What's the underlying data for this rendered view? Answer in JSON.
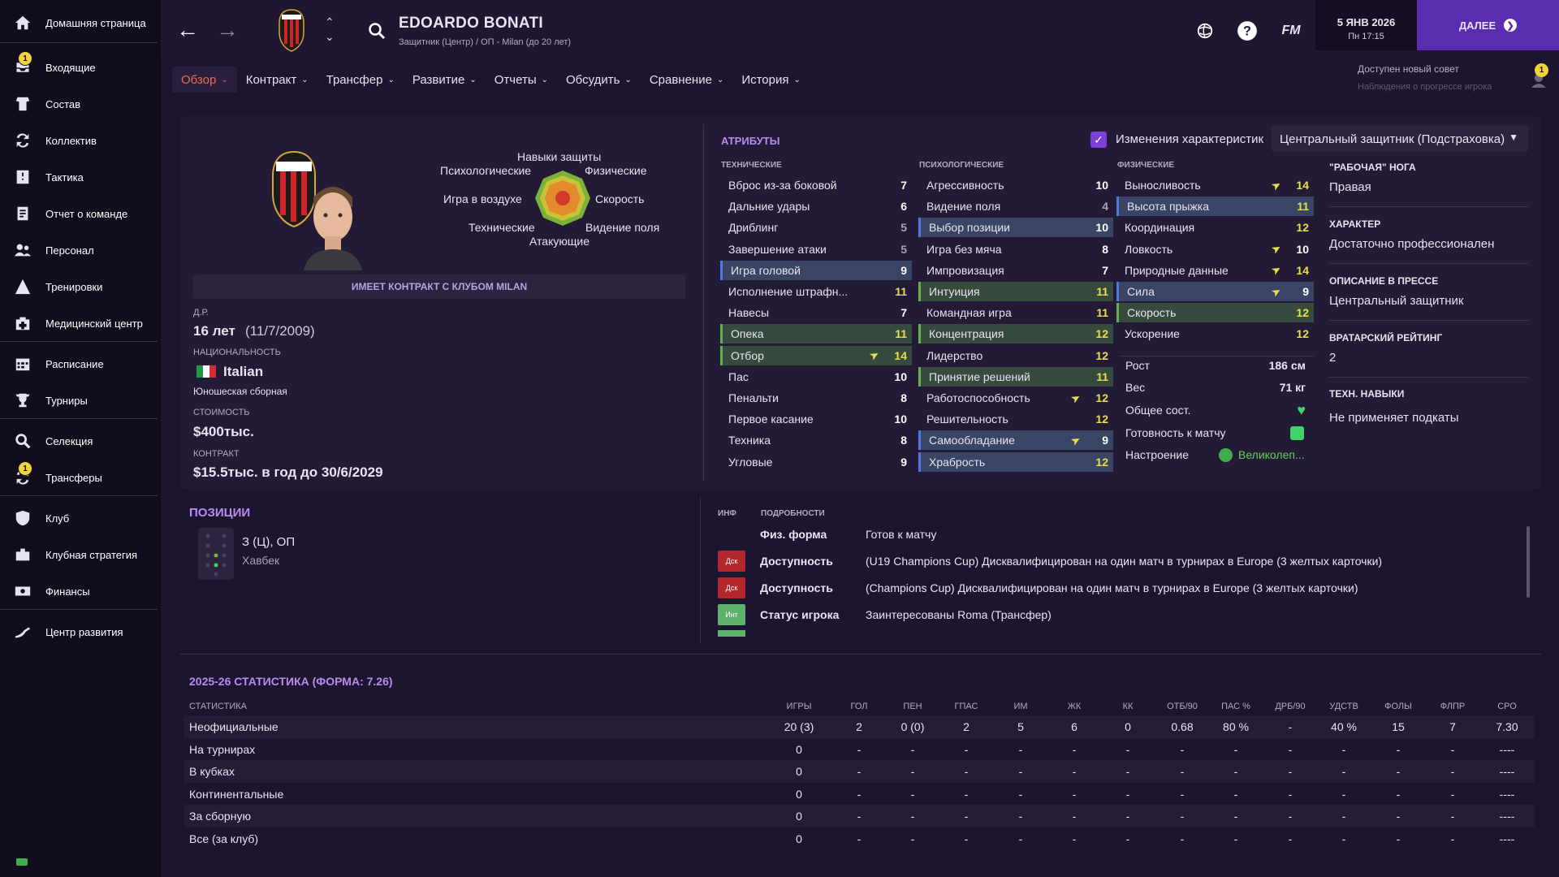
{
  "sidebar": {
    "items": [
      {
        "label": "Домашняя страница",
        "icon": "home-icon"
      },
      {
        "label": "Входящие",
        "icon": "inbox-icon",
        "badge": "1"
      },
      {
        "label": "Состав",
        "icon": "squad-icon"
      },
      {
        "label": "Коллектив",
        "icon": "dynamics-icon"
      },
      {
        "label": "Тактика",
        "icon": "tactics-icon"
      },
      {
        "label": "Отчет о команде",
        "icon": "report-icon"
      },
      {
        "label": "Персонал",
        "icon": "staff-icon"
      },
      {
        "label": "Тренировки",
        "icon": "training-icon"
      },
      {
        "label": "Медицинский центр",
        "icon": "medical-icon"
      },
      {
        "label": "Расписание",
        "icon": "calendar-icon"
      },
      {
        "label": "Турниры",
        "icon": "trophy-icon"
      },
      {
        "label": "Селекция",
        "icon": "scouting-icon"
      },
      {
        "label": "Трансферы",
        "icon": "transfers-icon",
        "badge": "1"
      },
      {
        "label": "Клуб",
        "icon": "club-icon"
      },
      {
        "label": "Клубная стратегия",
        "icon": "strategy-icon"
      },
      {
        "label": "Финансы",
        "icon": "finances-icon"
      },
      {
        "label": "Центр развития",
        "icon": "development-icon"
      }
    ]
  },
  "header": {
    "player_name": "EDOARDO BONATI",
    "player_sub": "Защитник (Центр) / ОП - Milan (до 20 лет)",
    "fm_logo": "FM",
    "date": "5 ЯНВ 2026",
    "day_time": "Пн 17:15",
    "next_label": "ДАЛЕЕ",
    "advice": "Доступен новый совет",
    "advice_sub": "Наблюдения о прогрессе игрока",
    "advice_badge": "1"
  },
  "tabs": [
    "Обзор",
    "Контракт",
    "Трансфер",
    "Развитие",
    "Отчеты",
    "Обсудить",
    "Сравнение",
    "История"
  ],
  "profile": {
    "radar": {
      "top": "Навыки защиты",
      "top_left": "Психологические",
      "top_right": "Физические",
      "left": "Игра в воздухе",
      "right": "Скорость",
      "bottom_left": "Технические",
      "bottom_right": "Видение поля",
      "bottom": "Атакующие"
    },
    "contract_bar": "ИМЕЕТ КОНТРАКТ С КЛУБОМ MILAN",
    "dob_label": "Д.Р.",
    "age": "16 лет",
    "dob": "(11/7/2009)",
    "nationality_label": "НАЦИОНАЛЬНОСТЬ",
    "nationality": "Italian",
    "nat_team": "Юношеская сборная",
    "value_label": "СТОИМОСТЬ",
    "value": "$400тыс.",
    "contract_label": "КОНТРАКТ",
    "contract": "$15.5тыс. в год до 30/6/2029"
  },
  "attributes": {
    "title": "АТРИБУТЫ",
    "changes_label": "Изменения характеристик",
    "role": "Центральный защитник (Подстраховка)",
    "technical_head": "ТЕХНИЧЕСКИЕ",
    "mental_head": "ПСИХОЛОГИЧЕСКИЕ",
    "physical_head": "ФИЗИЧЕСКИЕ",
    "technical": [
      {
        "name": "Вброс из-за боковой",
        "value": "7",
        "hl": "",
        "color": "white",
        "up": false
      },
      {
        "name": "Дальние удары",
        "value": "6",
        "hl": "",
        "color": "white",
        "up": false
      },
      {
        "name": "Дриблинг",
        "value": "5",
        "hl": "",
        "color": "grey",
        "up": false
      },
      {
        "name": "Завершение атаки",
        "value": "5",
        "hl": "",
        "color": "grey",
        "up": false
      },
      {
        "name": "Игра головой",
        "value": "9",
        "hl": "blue",
        "color": "white",
        "up": false
      },
      {
        "name": "Исполнение штрафн...",
        "value": "11",
        "hl": "",
        "color": "yellow",
        "up": false
      },
      {
        "name": "Навесы",
        "value": "7",
        "hl": "",
        "color": "white",
        "up": false
      },
      {
        "name": "Опека",
        "value": "11",
        "hl": "green",
        "color": "yellow",
        "up": false
      },
      {
        "name": "Отбор",
        "value": "14",
        "hl": "green",
        "color": "yellow",
        "up": true
      },
      {
        "name": "Пас",
        "value": "10",
        "hl": "",
        "color": "white",
        "up": false
      },
      {
        "name": "Пенальти",
        "value": "8",
        "hl": "",
        "color": "white",
        "up": false
      },
      {
        "name": "Первое касание",
        "value": "10",
        "hl": "",
        "color": "white",
        "up": false
      },
      {
        "name": "Техника",
        "value": "8",
        "hl": "",
        "color": "white",
        "up": false
      },
      {
        "name": "Угловые",
        "value": "9",
        "hl": "",
        "color": "white",
        "up": false
      }
    ],
    "mental": [
      {
        "name": "Агрессивность",
        "value": "10",
        "hl": "",
        "color": "white",
        "up": false
      },
      {
        "name": "Видение поля",
        "value": "4",
        "hl": "",
        "color": "grey",
        "up": false
      },
      {
        "name": "Выбор позиции",
        "value": "10",
        "hl": "blue",
        "color": "white",
        "up": false
      },
      {
        "name": "Игра без мяча",
        "value": "8",
        "hl": "",
        "color": "white",
        "up": false
      },
      {
        "name": "Импровизация",
        "value": "7",
        "hl": "",
        "color": "white",
        "up": false
      },
      {
        "name": "Интуиция",
        "value": "11",
        "hl": "green",
        "color": "yellow",
        "up": false
      },
      {
        "name": "Командная игра",
        "value": "11",
        "hl": "",
        "color": "yellow",
        "up": false
      },
      {
        "name": "Концентрация",
        "value": "12",
        "hl": "green",
        "color": "yellow",
        "up": false
      },
      {
        "name": "Лидерство",
        "value": "12",
        "hl": "",
        "color": "yellow",
        "up": false
      },
      {
        "name": "Принятие решений",
        "value": "11",
        "hl": "green",
        "color": "yellow",
        "up": false
      },
      {
        "name": "Работоспособность",
        "value": "12",
        "hl": "",
        "color": "yellow",
        "up": true
      },
      {
        "name": "Решительность",
        "value": "12",
        "hl": "",
        "color": "yellow",
        "up": false
      },
      {
        "name": "Самообладание",
        "value": "9",
        "hl": "blue",
        "color": "white",
        "up": true
      },
      {
        "name": "Храбрость",
        "value": "12",
        "hl": "blue",
        "color": "yellow",
        "up": false
      }
    ],
    "physical": [
      {
        "name": "Выносливость",
        "value": "14",
        "hl": "",
        "color": "yellow",
        "up": true
      },
      {
        "name": "Высота прыжка",
        "value": "11",
        "hl": "blue",
        "color": "yellow",
        "up": false
      },
      {
        "name": "Координация",
        "value": "12",
        "hl": "",
        "color": "yellow",
        "up": false
      },
      {
        "name": "Ловкость",
        "value": "10",
        "hl": "",
        "color": "white",
        "up": true
      },
      {
        "name": "Природные данные",
        "value": "14",
        "hl": "",
        "color": "yellow",
        "up": true
      },
      {
        "name": "Сила",
        "value": "9",
        "hl": "blue",
        "color": "white",
        "up": true
      },
      {
        "name": "Скорость",
        "value": "12",
        "hl": "green",
        "color": "yellow",
        "up": false
      },
      {
        "name": "Ускорение",
        "value": "12",
        "hl": "",
        "color": "yellow",
        "up": false
      }
    ],
    "height_label": "Рост",
    "height": "186 см",
    "weight_label": "Вес",
    "weight": "71 кг",
    "condition_label": "Общее сост.",
    "sharpness_label": "Готовность к матчу",
    "morale_label": "Настроение",
    "morale": "Великолеп..."
  },
  "info": {
    "foot_label": "\"РАБОЧАЯ\" НОГА",
    "foot": "Правая",
    "personality_label": "ХАРАКТЕР",
    "personality": "Достаточно профессионален",
    "media_label": "ОПИСАНИЕ В ПРЕССЕ",
    "media": "Центральный защитник",
    "gk_label": "ВРАТАРСКИЙ РЕЙТИНГ",
    "gk": "2",
    "traits_label": "ТЕХН. НАВЫКИ",
    "traits": "Не применяет подкаты"
  },
  "positions": {
    "title": "ПОЗИЦИИ",
    "primary": "З (Ц), ОП",
    "secondary": "Хавбек"
  },
  "details": {
    "head_inf": "ИНФ",
    "head_details": "ПОДРОБНОСТИ",
    "rows": [
      {
        "badge": "",
        "badge_color": "",
        "key": "Физ. форма",
        "value": "Готов к матчу"
      },
      {
        "badge": "Дск",
        "badge_color": "#b3262b",
        "key": "Доступность",
        "value": "(U19 Champions Cup) Дисквалифицирован на один матч в турнирах в Europe (3 желтых карточки)"
      },
      {
        "badge": "Дск",
        "badge_color": "#b3262b",
        "key": "Доступность",
        "value": "(Champions Cup) Дисквалифицирован на один матч в турнирах в Europe (3 желтых карточки)"
      },
      {
        "badge": "Инт",
        "badge_color": "#5fb06a",
        "key": "Статус игрока",
        "value": "Заинтересованы Roma (Трансфер)"
      }
    ]
  },
  "stats": {
    "title": "2025-26 СТАТИСТИКА (ФОРМА: 7.26)",
    "head_label": "СТАТИСТИКА",
    "columns": [
      "ИГРЫ",
      "ГОЛ",
      "ПЕН",
      "ГПАС",
      "ИМ",
      "ЖК",
      "КК",
      "ОТБ/90",
      "ПАС %",
      "ДРБ/90",
      "УДСТВ",
      "ФОЛЫ",
      "ФЛПР",
      "СРО"
    ],
    "rows": [
      {
        "name": "Неофициальные",
        "cells": [
          "20 (3)",
          "2",
          "0 (0)",
          "2",
          "5",
          "6",
          "0",
          "0.68",
          "80 %",
          "-",
          "40 %",
          "15",
          "7",
          "7.30"
        ]
      },
      {
        "name": "На турнирах",
        "cells": [
          "0",
          "-",
          "-",
          "-",
          "-",
          "-",
          "-",
          "-",
          "-",
          "-",
          "-",
          "-",
          "-",
          "----"
        ]
      },
      {
        "name": "В кубках",
        "cells": [
          "0",
          "-",
          "-",
          "-",
          "-",
          "-",
          "-",
          "-",
          "-",
          "-",
          "-",
          "-",
          "-",
          "----"
        ]
      },
      {
        "name": "Континентальные",
        "cells": [
          "0",
          "-",
          "-",
          "-",
          "-",
          "-",
          "-",
          "-",
          "-",
          "-",
          "-",
          "-",
          "-",
          "----"
        ]
      },
      {
        "name": "За сборную",
        "cells": [
          "0",
          "-",
          "-",
          "-",
          "-",
          "-",
          "-",
          "-",
          "-",
          "-",
          "-",
          "-",
          "-",
          "----"
        ]
      },
      {
        "name": "Все (за клуб)",
        "cells": [
          "0",
          "-",
          "-",
          "-",
          "-",
          "-",
          "-",
          "-",
          "-",
          "-",
          "-",
          "-",
          "-",
          "----"
        ]
      }
    ]
  },
  "colors": {
    "accent": "#b78cf0",
    "next_button": "#5b2bb0",
    "active_tab_text": "#e86a4f",
    "highlight_value": "#e8e04a"
  }
}
